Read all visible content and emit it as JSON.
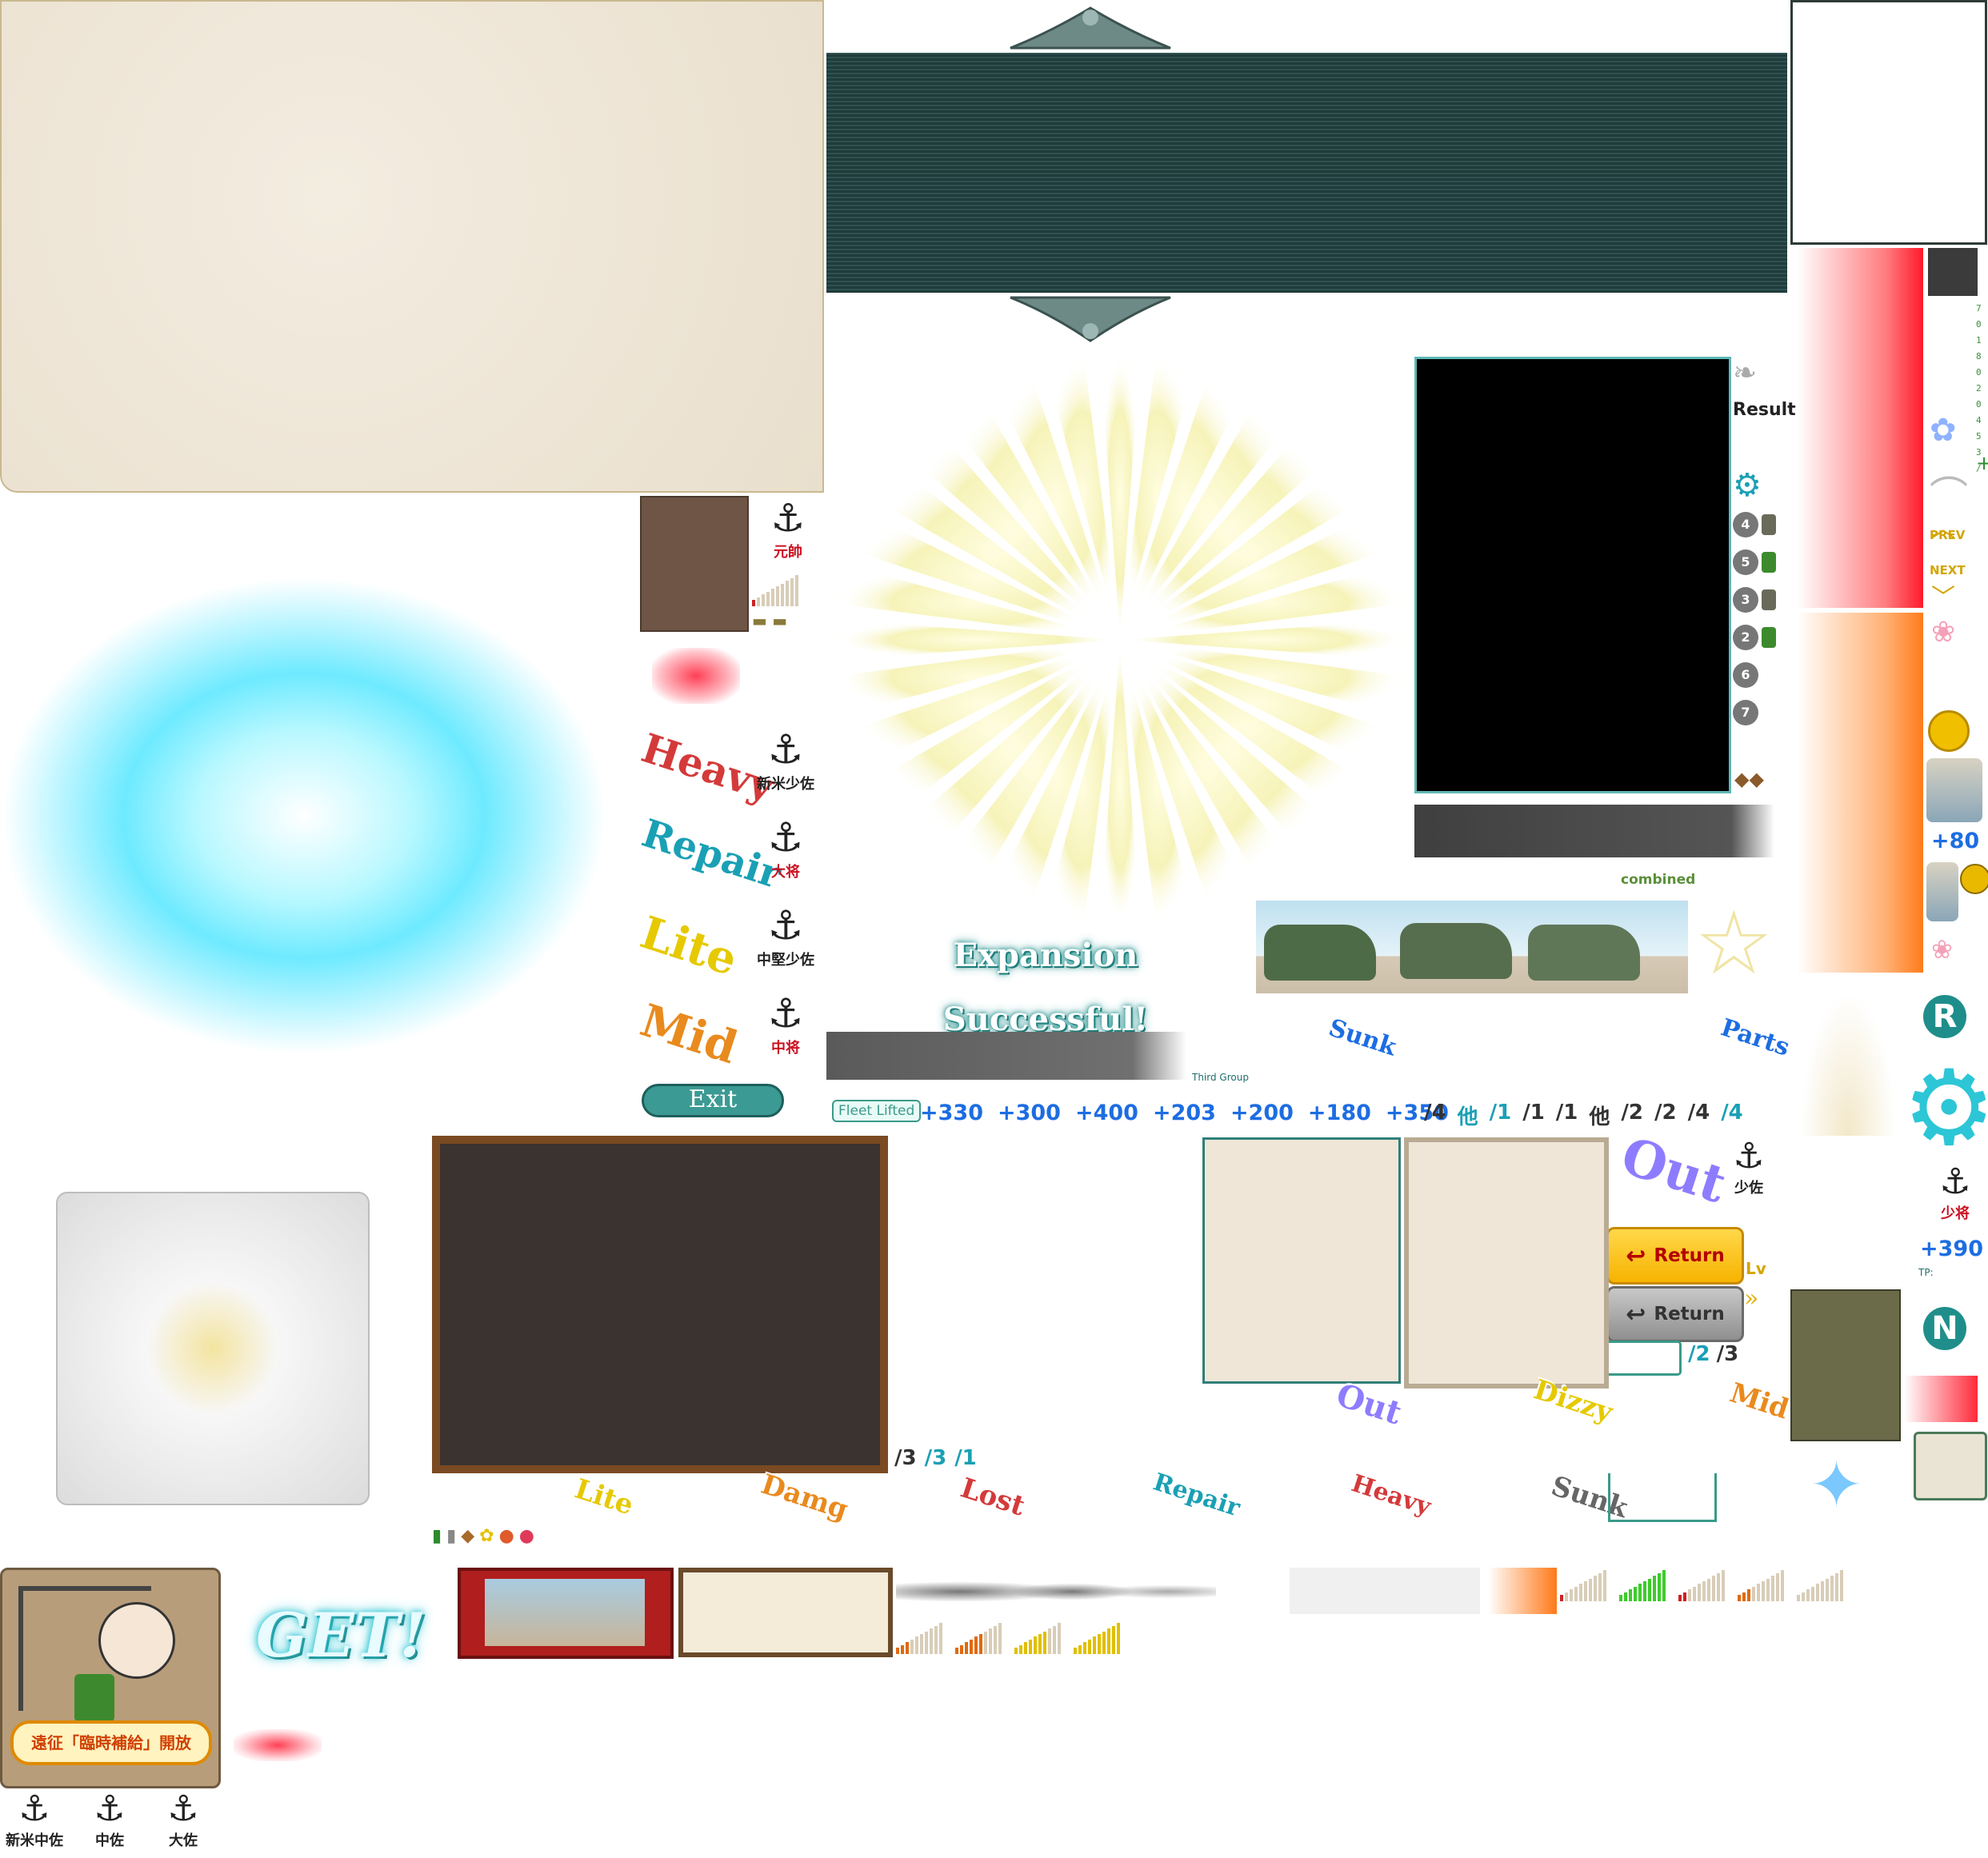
{
  "texts": {
    "result": "Result",
    "prev": "PREV",
    "next": "NEXT",
    "plus80": "+80",
    "combined": "combined",
    "expansion": "Expansion Successful!",
    "third_group": "Third Group",
    "fleet_lifted": "Fleet Lifted",
    "exit": "Exit",
    "return_label": "Return",
    "lv": "Lv",
    "plus390": "+390",
    "tp": "TP:",
    "get": "GET!",
    "expedition_banner": "遠征「臨時補給」開放",
    "r_letter": "R",
    "n_letter": "N",
    "side_digits": "7 0 1 8 0 2 0 4 5 3 /",
    "plus_mark": "+",
    "icon_other": "他"
  },
  "bonus_values": [
    "+330",
    "+300",
    "+400",
    "+203",
    "+200",
    "+180",
    "+350"
  ],
  "fractions_row": [
    "/4",
    "他",
    "/1",
    "/1",
    "/1",
    "他",
    "/2",
    "/2",
    "/4",
    "/4"
  ],
  "fractions_small": [
    "/3",
    "/3",
    "/1"
  ],
  "fractions_right": [
    "/2",
    "/3"
  ],
  "circle_numbers": [
    "4",
    "5",
    "3",
    "2",
    "6",
    "7"
  ],
  "damage_stamps_left": {
    "heavy": "Heavy",
    "repair": "Repair",
    "lite": "Lite",
    "mid": "Mid"
  },
  "damage_stamps_row": {
    "lite": "Lite",
    "damage": "Damg",
    "lost": "Lost",
    "repair": "Repair",
    "heavy": "Heavy",
    "sunk": "Sunk"
  },
  "damage_stamps_mid": {
    "sunk": "Sunk",
    "parts": "Parts",
    "out": "Out",
    "out_big": "Out",
    "dizzy": "Dizzy",
    "mid": "Mid"
  },
  "ranks": {
    "gensui": "元帥",
    "shinbei_shousa": "新米少佐",
    "taishou": "大将",
    "chuuken_shousa": "中堅少佐",
    "chuushou": "中将",
    "shousa": "少佐",
    "shoushou": "少将",
    "shinbei_chuusa": "新米中佐",
    "chuusa": "中佐",
    "taisa": "大佐"
  },
  "colors": {
    "teal": "#1f8e8b",
    "blue_number": "#1d6de2",
    "paper": "#efe6d8",
    "banner": "#24403f",
    "return_gold": "#f7b300",
    "return_grey": "#8f8f8f",
    "red_stamp": "#d43a3a",
    "yellow_stamp": "#e6c900",
    "orange_stamp": "#e98a1e",
    "cyan_glow": "#7cf2ff"
  },
  "icons": [
    "flame-icon",
    "gear-icon",
    "oil-barrel-icon",
    "steel-icon",
    "bauxite-icon",
    "ammo-icon",
    "star-outline-icon",
    "flower-icon",
    "anchor-icon",
    "sparkle-icon",
    "dock-icon"
  ]
}
